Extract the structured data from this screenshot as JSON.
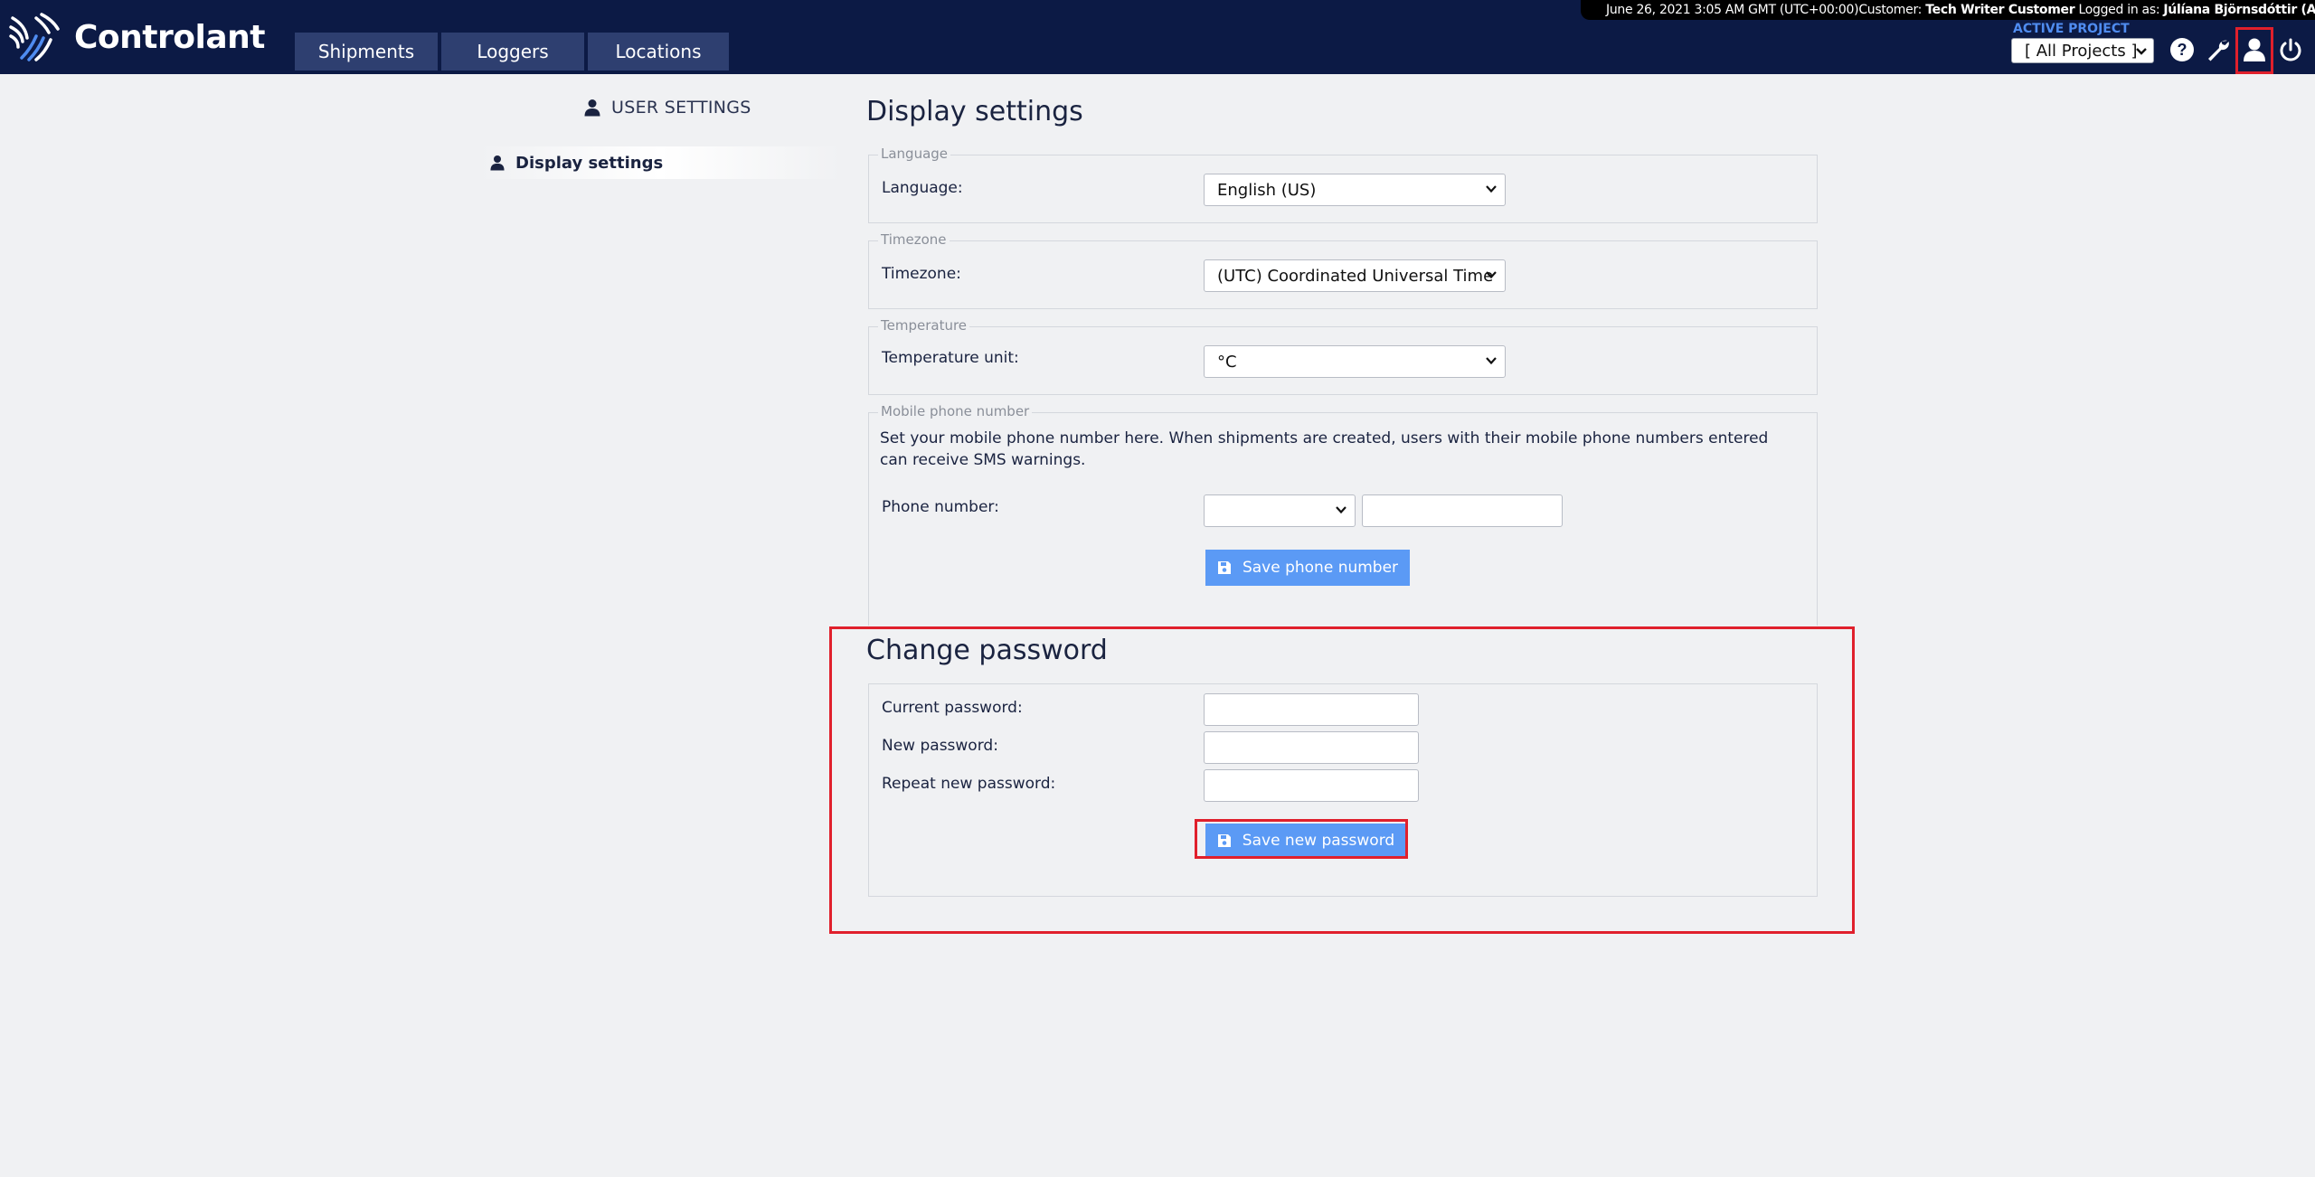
{
  "app": {
    "name": "Controlant",
    "brand_color": "#0c1a45",
    "accent_color": "#5b9af5",
    "highlight_color": "#e0202c"
  },
  "nav": {
    "tabs": [
      {
        "label": "Shipments"
      },
      {
        "label": "Loggers"
      },
      {
        "label": "Locations"
      }
    ]
  },
  "status": {
    "datetime": "June 26, 2021 3:05 AM GMT (UTC+00:00)",
    "customer_label": "Customer:",
    "customer_name": "Tech Writer Customer",
    "logged_in_label": "Logged in as:",
    "user_name": "Júlíana Björnsdóttir (ADMIN)"
  },
  "project": {
    "label": "ACTIVE PROJECT",
    "selected": "[ All Projects ]"
  },
  "icons": {
    "help": "question-circle-icon",
    "tools": "wrench-icon",
    "user": "user-icon",
    "logout": "power-icon"
  },
  "sidebar": {
    "title": "USER SETTINGS",
    "items": [
      {
        "label": "Display settings"
      }
    ]
  },
  "display_settings": {
    "title": "Display settings",
    "language": {
      "legend": "Language",
      "label": "Language:",
      "selected": "English (US)"
    },
    "timezone": {
      "legend": "Timezone",
      "label": "Timezone:",
      "selected": "(UTC) Coordinated Universal Time"
    },
    "temperature": {
      "legend": "Temperature",
      "label": "Temperature unit:",
      "selected": "°C"
    },
    "mobile": {
      "legend": "Mobile phone number",
      "description": "Set your mobile phone number here. When shipments are created, users with their mobile phone numbers entered can receive SMS warnings.",
      "label": "Phone number:",
      "country_code": "",
      "number": "",
      "save_label": "Save phone number"
    }
  },
  "change_password": {
    "title": "Change password",
    "current_label": "Current password:",
    "new_label": "New password:",
    "repeat_label": "Repeat new password:",
    "current_value": "",
    "new_value": "",
    "repeat_value": "",
    "save_label": "Save new password"
  }
}
